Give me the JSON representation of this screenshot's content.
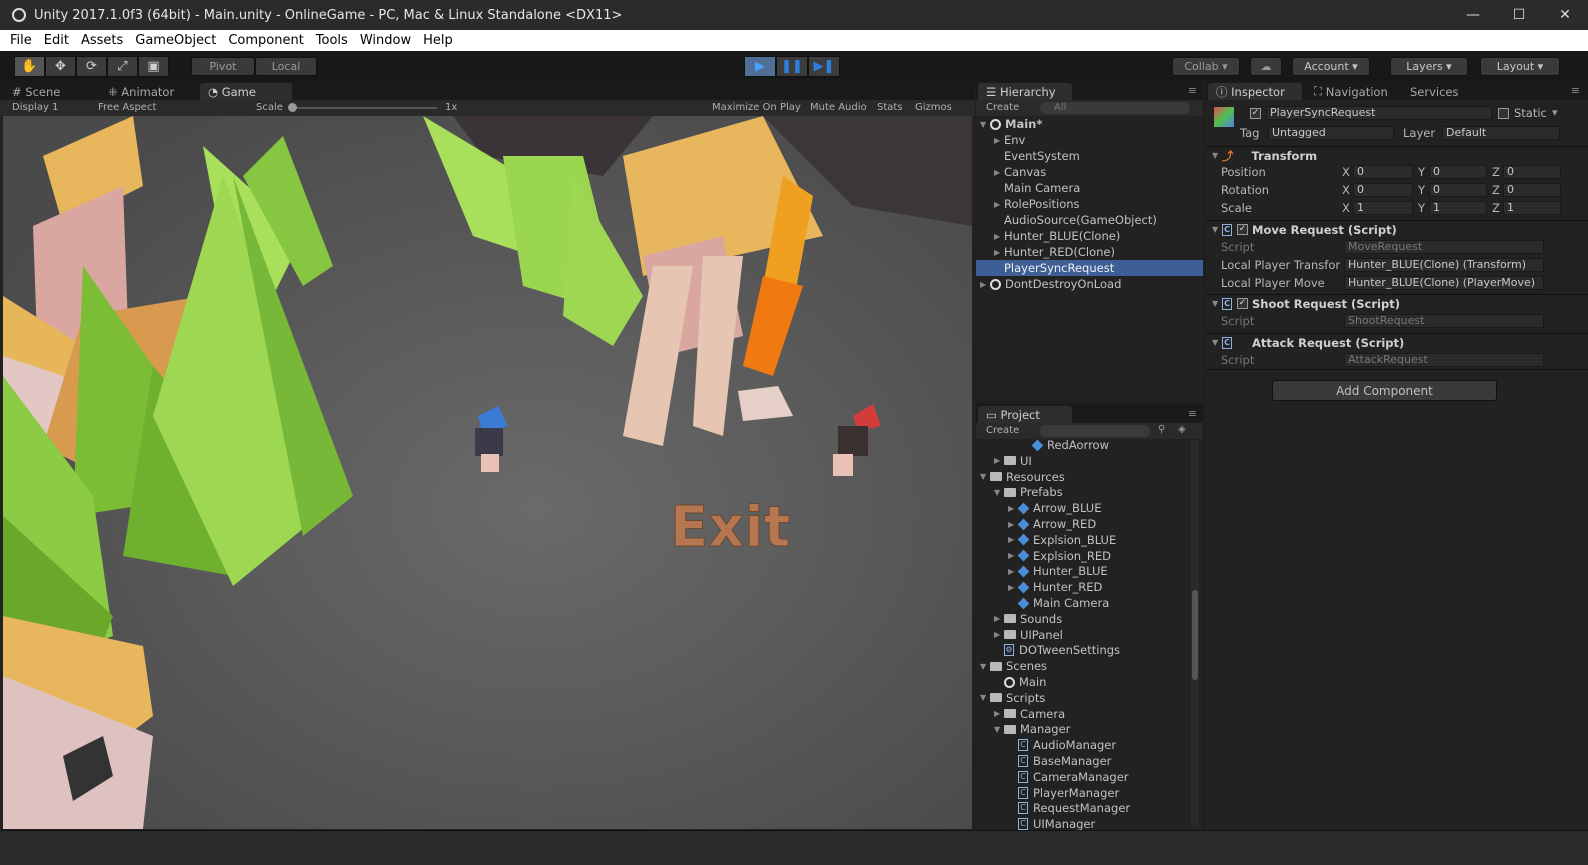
{
  "window": {
    "title": "Unity 2017.1.0f3 (64bit) - Main.unity - OnlineGame - PC, Mac & Linux Standalone <DX11>",
    "minimize": "—",
    "maximize": "☐",
    "close": "✕"
  },
  "menu": [
    "File",
    "Edit",
    "Assets",
    "GameObject",
    "Component",
    "Tools",
    "Window",
    "Help"
  ],
  "toolbar": {
    "tools": [
      "✋",
      "✥",
      "⟳",
      "⤢",
      "▣"
    ],
    "pivot": "Pivot",
    "local": "Local",
    "play": [
      "▶",
      "❚❚",
      "▶❚"
    ],
    "collab": "Collab",
    "cloud": "☁",
    "account": "Account",
    "layers": "Layers",
    "layout": "Layout"
  },
  "game_panel": {
    "tabs": [
      "Scene",
      "Animator",
      "Game"
    ],
    "display": "Display 1",
    "aspect": "Free Aspect",
    "scale_label": "Scale",
    "scale_value": "1x",
    "options": [
      "Maximize On Play",
      "Mute Audio",
      "Stats",
      "Gizmos"
    ],
    "exit_text": "Exit"
  },
  "hierarchy": {
    "tab": "Hierarchy",
    "create": "Create",
    "search_placeholder": "All",
    "scene": "Main*",
    "items": [
      "Env",
      "EventSystem",
      "Canvas",
      "Main Camera",
      "RolePositions",
      "AudioSource(GameObject)",
      "Hunter_BLUE(Clone)",
      "Hunter_RED(Clone)",
      "PlayerSyncRequest",
      "DontDestroyOnLoad"
    ]
  },
  "project": {
    "tab": "Project",
    "create": "Create",
    "items": [
      {
        "label": "RedAorrow",
        "indent": 3,
        "icon": "prefab"
      },
      {
        "label": "UI",
        "indent": 1,
        "icon": "folder",
        "arrow": "▶"
      },
      {
        "label": "Resources",
        "indent": 0,
        "icon": "folder",
        "arrow": "▼"
      },
      {
        "label": "Prefabs",
        "indent": 1,
        "icon": "folder",
        "arrow": "▼"
      },
      {
        "label": "Arrow_BLUE",
        "indent": 2,
        "icon": "prefab",
        "arrow": "▶"
      },
      {
        "label": "Arrow_RED",
        "indent": 2,
        "icon": "prefab",
        "arrow": "▶"
      },
      {
        "label": "Explsion_BLUE",
        "indent": 2,
        "icon": "prefab",
        "arrow": "▶"
      },
      {
        "label": "Explsion_RED",
        "indent": 2,
        "icon": "prefab",
        "arrow": "▶"
      },
      {
        "label": "Hunter_BLUE",
        "indent": 2,
        "icon": "prefab",
        "arrow": "▶"
      },
      {
        "label": "Hunter_RED",
        "indent": 2,
        "icon": "prefab",
        "arrow": "▶"
      },
      {
        "label": "Main Camera",
        "indent": 2,
        "icon": "prefab"
      },
      {
        "label": "Sounds",
        "indent": 1,
        "icon": "folder",
        "arrow": "▶"
      },
      {
        "label": "UIPanel",
        "indent": 1,
        "icon": "folder",
        "arrow": "▶"
      },
      {
        "label": "DOTweenSettings",
        "indent": 1,
        "icon": "settings"
      },
      {
        "label": "Scenes",
        "indent": 0,
        "icon": "folder",
        "arrow": "▼"
      },
      {
        "label": "Main",
        "indent": 1,
        "icon": "unity"
      },
      {
        "label": "Scripts",
        "indent": 0,
        "icon": "folder",
        "arrow": "▼"
      },
      {
        "label": "Camera",
        "indent": 1,
        "icon": "folder",
        "arrow": "▶"
      },
      {
        "label": "Manager",
        "indent": 1,
        "icon": "folder",
        "arrow": "▼"
      },
      {
        "label": "AudioManager",
        "indent": 2,
        "icon": "script"
      },
      {
        "label": "BaseManager",
        "indent": 2,
        "icon": "script"
      },
      {
        "label": "CameraManager",
        "indent": 2,
        "icon": "script"
      },
      {
        "label": "PlayerManager",
        "indent": 2,
        "icon": "script"
      },
      {
        "label": "RequestManager",
        "indent": 2,
        "icon": "script"
      },
      {
        "label": "UIManager",
        "indent": 2,
        "icon": "script"
      }
    ]
  },
  "inspector": {
    "tabs": [
      "Inspector",
      "Navigation",
      "Services"
    ],
    "object_name": "PlayerSyncRequest",
    "static_label": "Static",
    "tag_label": "Tag",
    "tag_value": "Untagged",
    "layer_label": "Layer",
    "layer_value": "Default",
    "transform": {
      "title": "Transform",
      "rows": [
        {
          "label": "Position",
          "x": "0",
          "y": "0",
          "z": "0"
        },
        {
          "label": "Rotation",
          "x": "0",
          "y": "0",
          "z": "0"
        },
        {
          "label": "Scale",
          "x": "1",
          "y": "1",
          "z": "1"
        }
      ]
    },
    "axis": {
      "x": "X",
      "y": "Y",
      "z": "Z"
    },
    "move": {
      "title": "Move Request (Script)",
      "script_label": "Script",
      "script_value": "MoveRequest",
      "f1_label": "Local Player Transfor",
      "f1_value": "Hunter_BLUE(Clone) (Transform)",
      "f2_label": "Local Player Move",
      "f2_value": "Hunter_BLUE(Clone) (PlayerMove)"
    },
    "shoot": {
      "title": "Shoot Request (Script)",
      "script_label": "Script",
      "script_value": "ShootRequest"
    },
    "attack": {
      "title": "Attack Request (Script)",
      "script_label": "Script",
      "script_value": "AttackRequest"
    },
    "add_component": "Add Component"
  }
}
